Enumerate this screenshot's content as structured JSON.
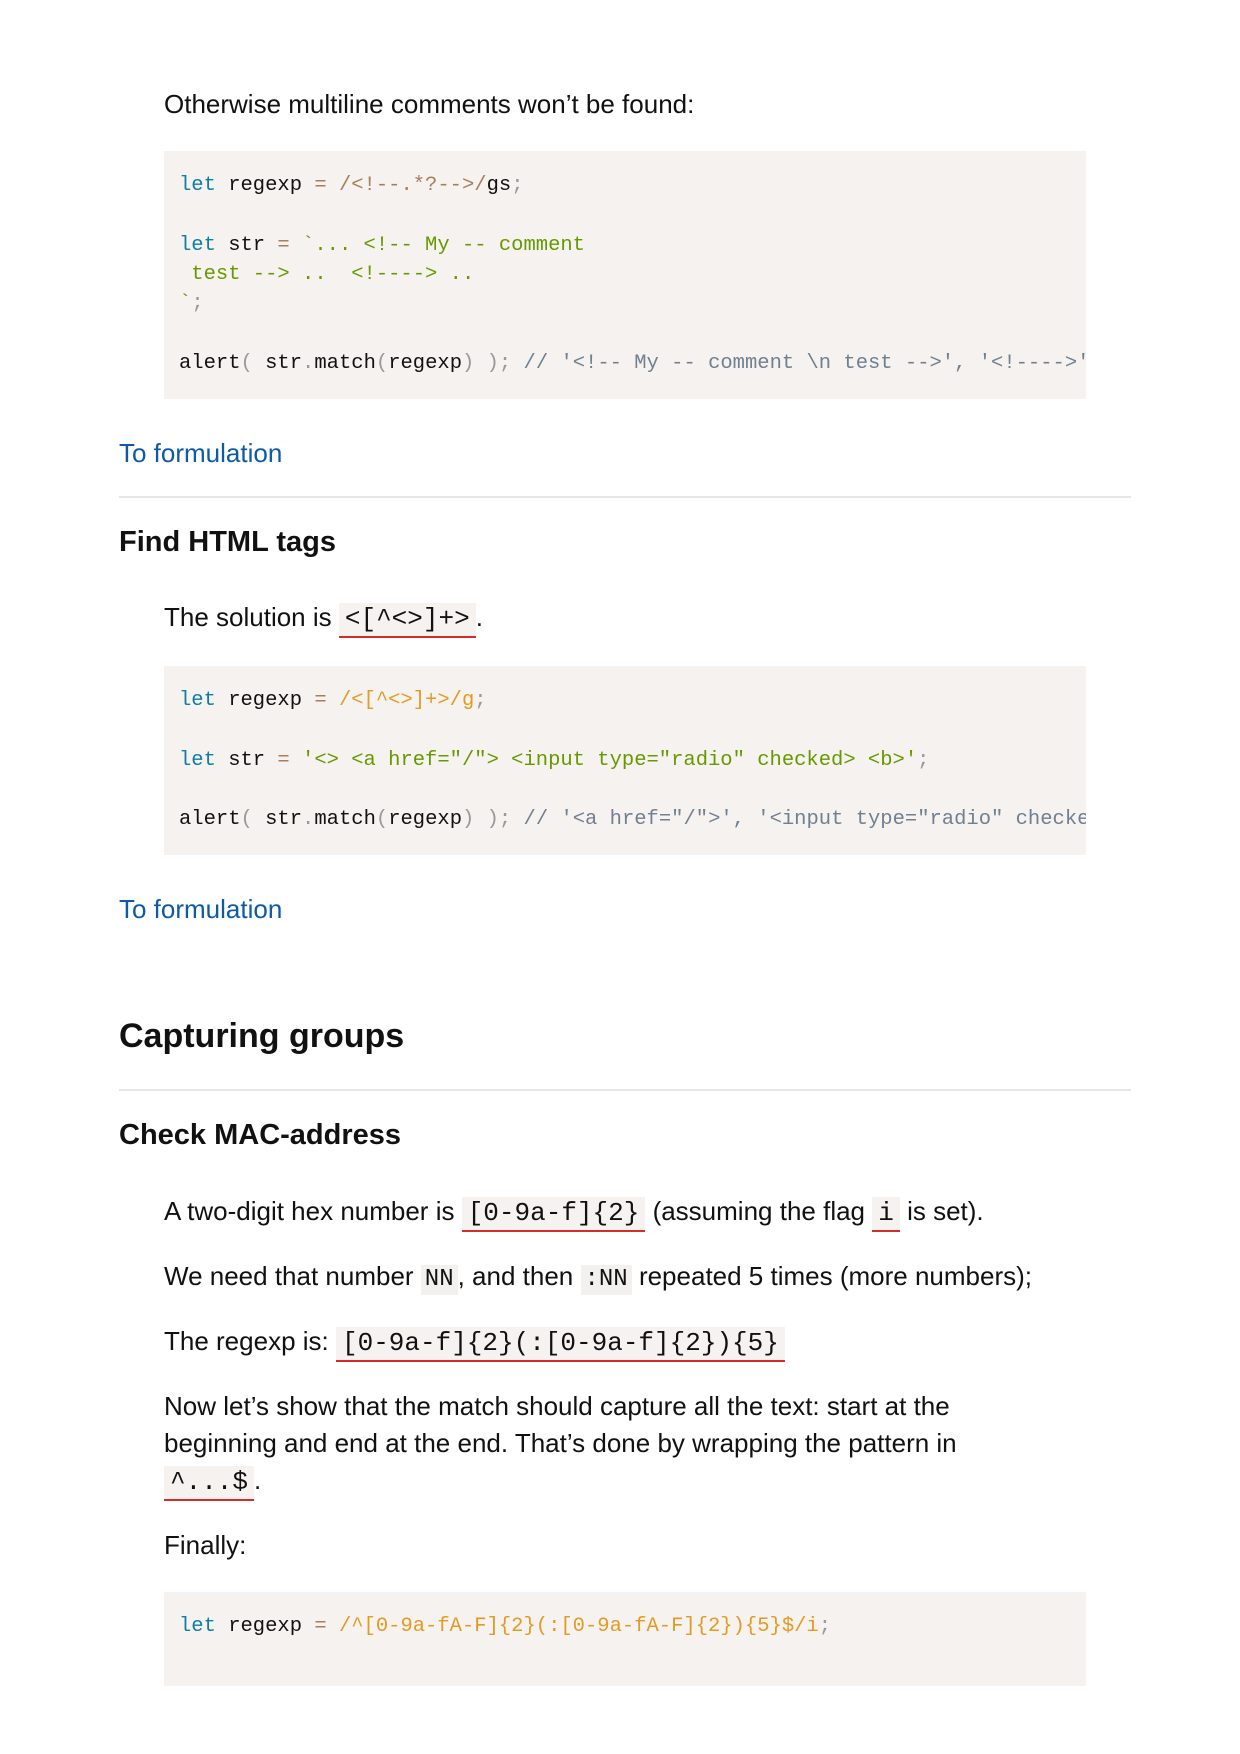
{
  "sections": {
    "comments": {
      "intro": "Otherwise multiline comments won’t be found:",
      "code": {
        "l1_kw": "let",
        "l1_var": " regexp ",
        "l1_eq": "=",
        "l1_rx": " /<!--.*?-->/",
        "l1_flags": "gs",
        "l1_semi": ";",
        "l2_kw": "let",
        "l2_var": " str ",
        "l2_eq": "=",
        "l2_str": " `... <!-- My -- comment",
        "l3_str": " test --> ..  <!----> ..",
        "l4_str": "`",
        "l4_semi": ";",
        "l5_fn": "alert",
        "l5_p1": "(",
        "l5_obj": " str",
        "l5_dot": ".",
        "l5_method": "match",
        "l5_p2": "(",
        "l5_arg": "regexp",
        "l5_p3": ")",
        "l5_p4": " )",
        "l5_semi": ";",
        "l5_comment": " // '<!-- My -- comment \\n test -->', '<!---->'"
      },
      "link": "To formulation"
    },
    "html_tags": {
      "title": "Find HTML tags",
      "solution_prefix": "The solution is ",
      "solution_code": "<[^<>]+>",
      "solution_suffix": ".",
      "code": {
        "l1_kw": "let",
        "l1_var": " regexp ",
        "l1_eq": "=",
        "l1_rx": " /<[^<>]+>/g",
        "l1_semi": ";",
        "l2_kw": "let",
        "l2_var": " str ",
        "l2_eq": "=",
        "l2_str": " '<> <a href=\"/\"> <input type=\"radio\" checked> <b>'",
        "l2_semi": ";",
        "l3_fn": "alert",
        "l3_p1": "(",
        "l3_obj": " str",
        "l3_dot": ".",
        "l3_method": "match",
        "l3_p2": "(",
        "l3_arg": "regexp",
        "l3_p3": ")",
        "l3_p4": " )",
        "l3_semi": ";",
        "l3_comment": " // '<a href=\"/\">', '<input type=\"radio\" checked>', '<b>'"
      },
      "link": "To formulation"
    },
    "capturing_groups": {
      "title": "Capturing groups"
    },
    "mac": {
      "title": "Check MAC-address",
      "p1_a": "A two-digit hex number is ",
      "p1_code": "[0-9a-f]{2}",
      "p1_b": " (assuming the flag ",
      "p1_code2": "i",
      "p1_c": " is set).",
      "p2_a": "We need that number ",
      "p2_code": "NN",
      "p2_b": ", and then ",
      "p2_code2": ":NN",
      "p2_c": " repeated 5 times (more numbers);",
      "p3_a": "The regexp is: ",
      "p3_code": "[0-9a-f]{2}(:[0-9a-f]{2}){5}",
      "p4_line1": "Now let’s show that the match should capture all the text: start at the",
      "p4_line2": "beginning and end at the end. That’s done by wrapping the pattern in",
      "p4_code": "^...$",
      "p4_suffix": ".",
      "p5": "Finally:",
      "code": {
        "l1_kw": "let",
        "l1_var": " regexp ",
        "l1_eq": "=",
        "l1_rx": " /^[0-9a-fA-F]{2}(:[0-9a-fA-F]{2}){5}$/i",
        "l1_semi": ";"
      }
    }
  }
}
